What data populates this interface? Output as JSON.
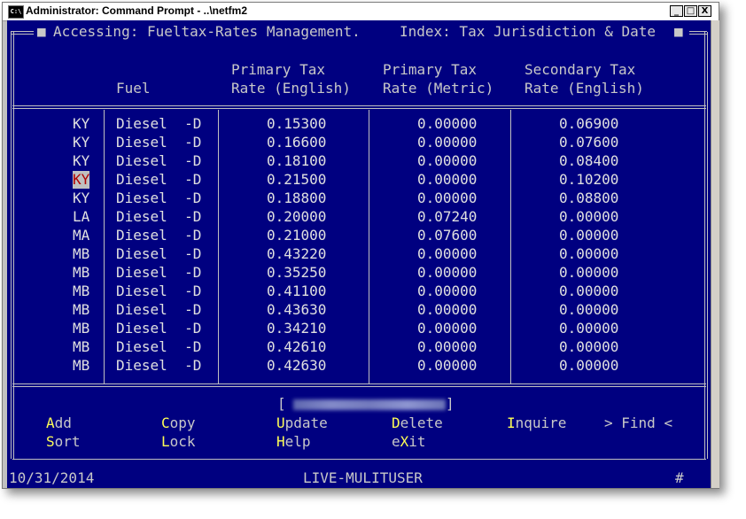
{
  "window": {
    "title": "Administrator: Command Prompt - ..\\netfm2",
    "icon_label": "C:\\",
    "minimize_glyph": "_",
    "maximize_glyph": "□",
    "close_glyph": "X"
  },
  "header": {
    "accessing": "Accessing: Fueltax-Rates Management.",
    "index": "Index: Tax Jurisdiction & Date"
  },
  "columns": {
    "fuel": "Fuel",
    "primary_english_1": "Primary Tax",
    "primary_english_2": "Rate (English)",
    "primary_metric_1": "Primary Tax",
    "primary_metric_2": "Rate (Metric)",
    "secondary_english_1": "Secondary Tax",
    "secondary_english_2": "Rate (English)"
  },
  "rows": [
    {
      "jur": "KY",
      "fuel": "Diesel  -D",
      "primary_english": "0.15300",
      "primary_metric": "0.00000",
      "secondary_english": "0.06900"
    },
    {
      "jur": "KY",
      "fuel": "Diesel  -D",
      "primary_english": "0.16600",
      "primary_metric": "0.00000",
      "secondary_english": "0.07600"
    },
    {
      "jur": "KY",
      "fuel": "Diesel  -D",
      "primary_english": "0.18100",
      "primary_metric": "0.00000",
      "secondary_english": "0.08400"
    },
    {
      "jur": "KY",
      "fuel": "Diesel  -D",
      "primary_english": "0.21500",
      "primary_metric": "0.00000",
      "secondary_english": "0.10200"
    },
    {
      "jur": "KY",
      "fuel": "Diesel  -D",
      "primary_english": "0.18800",
      "primary_metric": "0.00000",
      "secondary_english": "0.08800"
    },
    {
      "jur": "LA",
      "fuel": "Diesel  -D",
      "primary_english": "0.20000",
      "primary_metric": "0.07240",
      "secondary_english": "0.00000"
    },
    {
      "jur": "MA",
      "fuel": "Diesel  -D",
      "primary_english": "0.21000",
      "primary_metric": "0.07600",
      "secondary_english": "0.00000"
    },
    {
      "jur": "MB",
      "fuel": "Diesel  -D",
      "primary_english": "0.43220",
      "primary_metric": "0.00000",
      "secondary_english": "0.00000"
    },
    {
      "jur": "MB",
      "fuel": "Diesel  -D",
      "primary_english": "0.35250",
      "primary_metric": "0.00000",
      "secondary_english": "0.00000"
    },
    {
      "jur": "MB",
      "fuel": "Diesel  -D",
      "primary_english": "0.41100",
      "primary_metric": "0.00000",
      "secondary_english": "0.00000"
    },
    {
      "jur": "MB",
      "fuel": "Diesel  -D",
      "primary_english": "0.43630",
      "primary_metric": "0.00000",
      "secondary_english": "0.00000"
    },
    {
      "jur": "MB",
      "fuel": "Diesel  -D",
      "primary_english": "0.34210",
      "primary_metric": "0.00000",
      "secondary_english": "0.00000"
    },
    {
      "jur": "MB",
      "fuel": "Diesel  -D",
      "primary_english": "0.42610",
      "primary_metric": "0.00000",
      "secondary_english": "0.00000"
    },
    {
      "jur": "MB",
      "fuel": "Diesel  -D",
      "primary_english": "0.42630",
      "primary_metric": "0.00000",
      "secondary_english": "0.00000"
    }
  ],
  "selected_row": 3,
  "status_box": {
    "left_bracket": "[",
    "right_bracket": "]"
  },
  "menu": {
    "add": {
      "key": "A",
      "rest": "dd"
    },
    "copy": {
      "key": "C",
      "rest": "opy"
    },
    "update": {
      "key": "U",
      "rest": "pdate"
    },
    "delete": {
      "key": "D",
      "rest": "elete"
    },
    "inquire": {
      "key": "I",
      "rest": "nquire"
    },
    "find": {
      "pre": "> ",
      "key": "F",
      "rest": "ind <"
    },
    "sort": {
      "key": "S",
      "rest": "ort"
    },
    "lock": {
      "key": "L",
      "rest": "ock"
    },
    "help": {
      "key": "H",
      "rest": "elp"
    },
    "exit": {
      "pre": "e",
      "key": "X",
      "rest": "it"
    }
  },
  "footer": {
    "date": "10/31/2014",
    "mode": "LIVE-MULITUSER",
    "hash": "#"
  },
  "colors": {
    "console_bg": "#000080",
    "text": "#c0c0c0",
    "hotkey": "#ffff55",
    "selected_bg": "#c0c0c0",
    "selected_fg": "#b00000"
  }
}
